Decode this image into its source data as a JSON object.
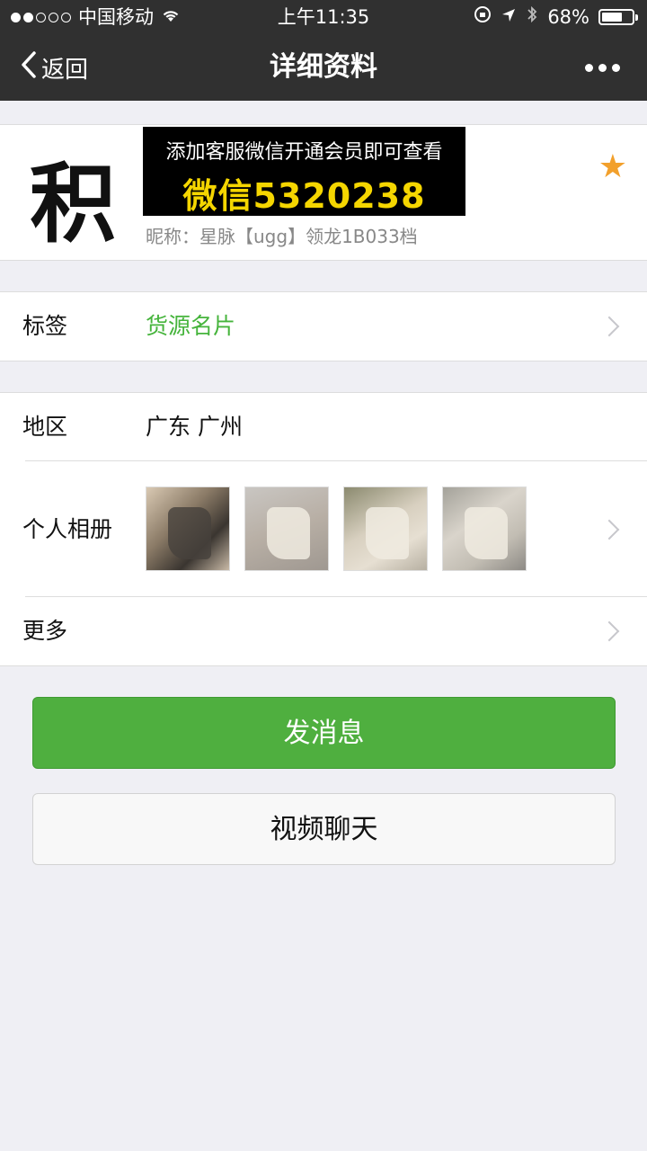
{
  "status_bar": {
    "carrier": "中国移动",
    "time": "上午11:35",
    "battery": "68%",
    "battery_level": 0.68
  },
  "nav": {
    "back_label": "返回",
    "title": "详细资料"
  },
  "profile": {
    "avatar_char": "积",
    "promo_line1": "添加客服微信开通会员即可查看",
    "promo_line2": "微信5320238",
    "nickname": "昵称：星脉【ugg】领龙1B033档"
  },
  "rows": {
    "tag": {
      "label": "标签",
      "value": "货源名片"
    },
    "region": {
      "label": "地区",
      "value": "广东 广州"
    },
    "album": {
      "label": "个人相册"
    },
    "more": {
      "label": "更多"
    }
  },
  "buttons": {
    "send_message": "发消息",
    "video_chat": "视频聊天"
  },
  "colors": {
    "accent_green": "#4faf3f",
    "tag_green": "#46b43c",
    "star": "#f2a02c",
    "promo_yellow": "#f5d600"
  }
}
